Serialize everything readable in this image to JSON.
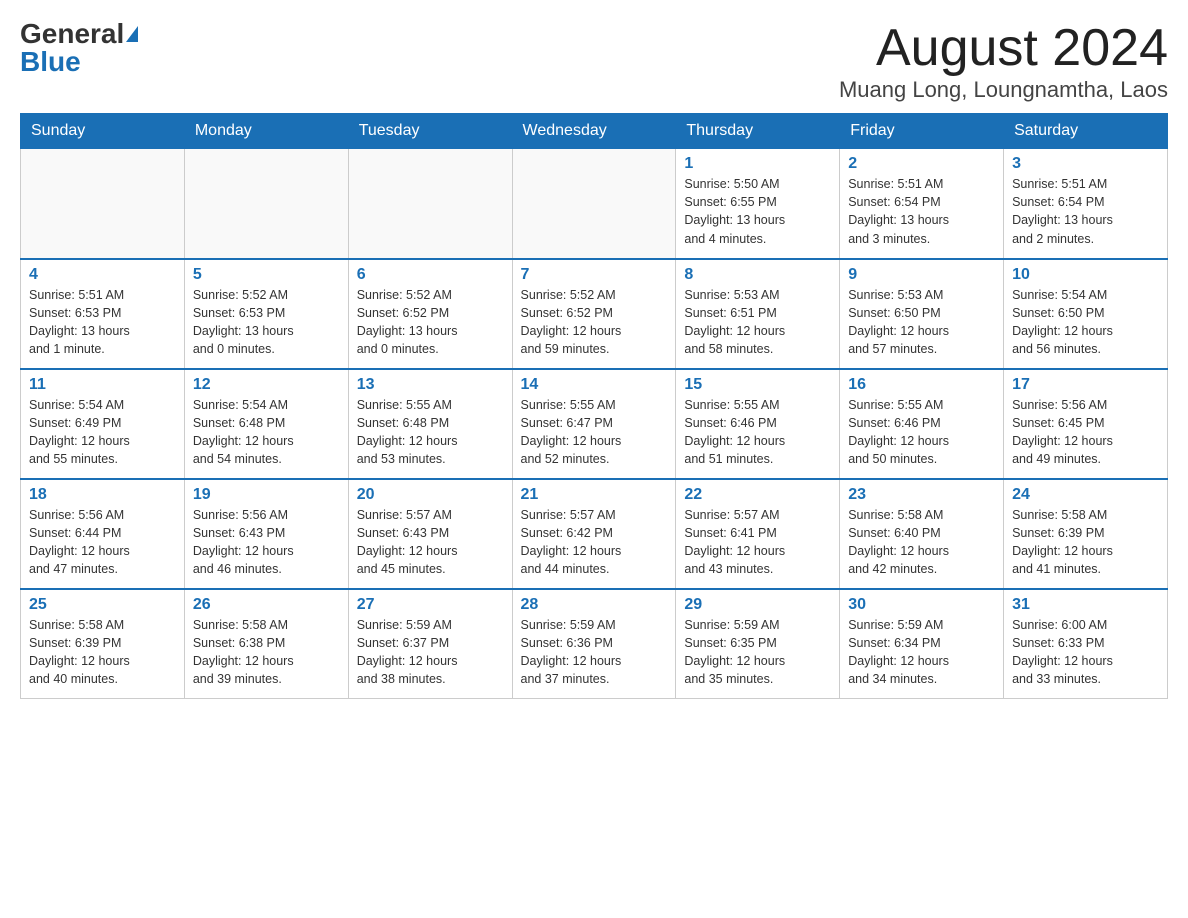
{
  "header": {
    "logo_general": "General",
    "logo_blue": "Blue",
    "month_title": "August 2024",
    "location": "Muang Long, Loungnamtha, Laos"
  },
  "weekdays": [
    "Sunday",
    "Monday",
    "Tuesday",
    "Wednesday",
    "Thursday",
    "Friday",
    "Saturday"
  ],
  "weeks": [
    [
      {
        "day": "",
        "info": ""
      },
      {
        "day": "",
        "info": ""
      },
      {
        "day": "",
        "info": ""
      },
      {
        "day": "",
        "info": ""
      },
      {
        "day": "1",
        "info": "Sunrise: 5:50 AM\nSunset: 6:55 PM\nDaylight: 13 hours\nand 4 minutes."
      },
      {
        "day": "2",
        "info": "Sunrise: 5:51 AM\nSunset: 6:54 PM\nDaylight: 13 hours\nand 3 minutes."
      },
      {
        "day": "3",
        "info": "Sunrise: 5:51 AM\nSunset: 6:54 PM\nDaylight: 13 hours\nand 2 minutes."
      }
    ],
    [
      {
        "day": "4",
        "info": "Sunrise: 5:51 AM\nSunset: 6:53 PM\nDaylight: 13 hours\nand 1 minute."
      },
      {
        "day": "5",
        "info": "Sunrise: 5:52 AM\nSunset: 6:53 PM\nDaylight: 13 hours\nand 0 minutes."
      },
      {
        "day": "6",
        "info": "Sunrise: 5:52 AM\nSunset: 6:52 PM\nDaylight: 13 hours\nand 0 minutes."
      },
      {
        "day": "7",
        "info": "Sunrise: 5:52 AM\nSunset: 6:52 PM\nDaylight: 12 hours\nand 59 minutes."
      },
      {
        "day": "8",
        "info": "Sunrise: 5:53 AM\nSunset: 6:51 PM\nDaylight: 12 hours\nand 58 minutes."
      },
      {
        "day": "9",
        "info": "Sunrise: 5:53 AM\nSunset: 6:50 PM\nDaylight: 12 hours\nand 57 minutes."
      },
      {
        "day": "10",
        "info": "Sunrise: 5:54 AM\nSunset: 6:50 PM\nDaylight: 12 hours\nand 56 minutes."
      }
    ],
    [
      {
        "day": "11",
        "info": "Sunrise: 5:54 AM\nSunset: 6:49 PM\nDaylight: 12 hours\nand 55 minutes."
      },
      {
        "day": "12",
        "info": "Sunrise: 5:54 AM\nSunset: 6:48 PM\nDaylight: 12 hours\nand 54 minutes."
      },
      {
        "day": "13",
        "info": "Sunrise: 5:55 AM\nSunset: 6:48 PM\nDaylight: 12 hours\nand 53 minutes."
      },
      {
        "day": "14",
        "info": "Sunrise: 5:55 AM\nSunset: 6:47 PM\nDaylight: 12 hours\nand 52 minutes."
      },
      {
        "day": "15",
        "info": "Sunrise: 5:55 AM\nSunset: 6:46 PM\nDaylight: 12 hours\nand 51 minutes."
      },
      {
        "day": "16",
        "info": "Sunrise: 5:55 AM\nSunset: 6:46 PM\nDaylight: 12 hours\nand 50 minutes."
      },
      {
        "day": "17",
        "info": "Sunrise: 5:56 AM\nSunset: 6:45 PM\nDaylight: 12 hours\nand 49 minutes."
      }
    ],
    [
      {
        "day": "18",
        "info": "Sunrise: 5:56 AM\nSunset: 6:44 PM\nDaylight: 12 hours\nand 47 minutes."
      },
      {
        "day": "19",
        "info": "Sunrise: 5:56 AM\nSunset: 6:43 PM\nDaylight: 12 hours\nand 46 minutes."
      },
      {
        "day": "20",
        "info": "Sunrise: 5:57 AM\nSunset: 6:43 PM\nDaylight: 12 hours\nand 45 minutes."
      },
      {
        "day": "21",
        "info": "Sunrise: 5:57 AM\nSunset: 6:42 PM\nDaylight: 12 hours\nand 44 minutes."
      },
      {
        "day": "22",
        "info": "Sunrise: 5:57 AM\nSunset: 6:41 PM\nDaylight: 12 hours\nand 43 minutes."
      },
      {
        "day": "23",
        "info": "Sunrise: 5:58 AM\nSunset: 6:40 PM\nDaylight: 12 hours\nand 42 minutes."
      },
      {
        "day": "24",
        "info": "Sunrise: 5:58 AM\nSunset: 6:39 PM\nDaylight: 12 hours\nand 41 minutes."
      }
    ],
    [
      {
        "day": "25",
        "info": "Sunrise: 5:58 AM\nSunset: 6:39 PM\nDaylight: 12 hours\nand 40 minutes."
      },
      {
        "day": "26",
        "info": "Sunrise: 5:58 AM\nSunset: 6:38 PM\nDaylight: 12 hours\nand 39 minutes."
      },
      {
        "day": "27",
        "info": "Sunrise: 5:59 AM\nSunset: 6:37 PM\nDaylight: 12 hours\nand 38 minutes."
      },
      {
        "day": "28",
        "info": "Sunrise: 5:59 AM\nSunset: 6:36 PM\nDaylight: 12 hours\nand 37 minutes."
      },
      {
        "day": "29",
        "info": "Sunrise: 5:59 AM\nSunset: 6:35 PM\nDaylight: 12 hours\nand 35 minutes."
      },
      {
        "day": "30",
        "info": "Sunrise: 5:59 AM\nSunset: 6:34 PM\nDaylight: 12 hours\nand 34 minutes."
      },
      {
        "day": "31",
        "info": "Sunrise: 6:00 AM\nSunset: 6:33 PM\nDaylight: 12 hours\nand 33 minutes."
      }
    ]
  ]
}
